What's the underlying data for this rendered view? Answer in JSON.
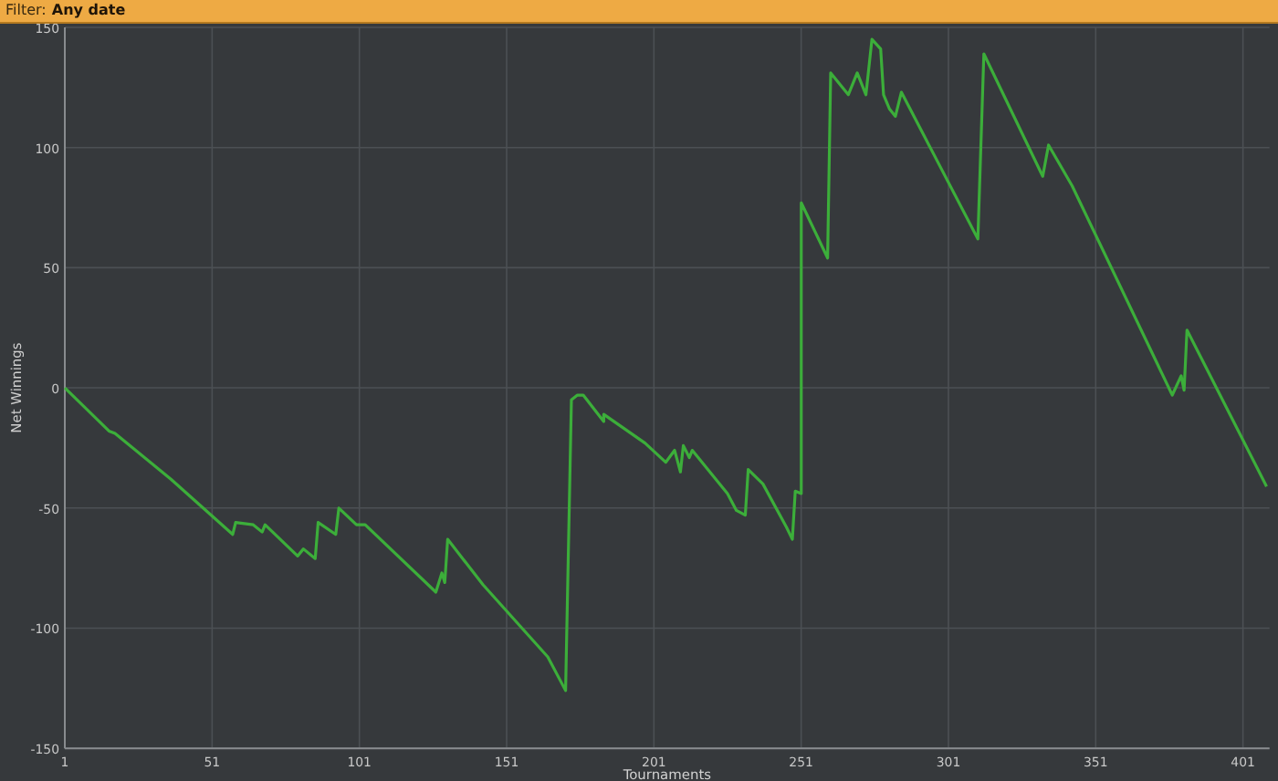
{
  "filter_bar": {
    "label": "Filter:",
    "value": "Any date"
  },
  "chart": {
    "chart_data": {
      "type": "line",
      "xlabel": "Tournaments",
      "ylabel": "Net Winnings",
      "xlim": [
        1,
        410
      ],
      "ylim": [
        -150,
        150
      ],
      "xticks": [
        1,
        51,
        101,
        151,
        201,
        251,
        301,
        351,
        401
      ],
      "yticks": [
        -150,
        -100,
        -50,
        0,
        50,
        100,
        150
      ],
      "x": [
        1,
        16,
        18,
        34,
        37,
        58,
        59,
        65,
        68,
        69,
        80,
        82,
        86,
        87,
        93,
        94,
        100,
        103,
        127,
        129,
        130,
        131,
        143,
        165,
        171,
        173,
        175,
        177,
        184,
        184,
        198,
        205,
        208,
        210,
        211,
        213,
        214,
        226,
        229,
        232,
        233,
        238,
        246,
        248,
        249,
        251,
        251,
        260,
        261,
        267,
        270,
        273,
        275,
        278,
        279,
        281,
        283,
        285,
        311,
        313,
        333,
        335,
        343,
        377,
        380,
        381,
        382,
        409
      ],
      "grid": true,
      "series": [
        {
          "color": "#3cae3a",
          "values": [
            0,
            -18,
            -19,
            -35,
            -38,
            -61,
            -56,
            -57,
            -60,
            -57,
            -70,
            -67,
            -71,
            -56,
            -61,
            -50,
            -57,
            -57,
            -85,
            -77,
            -81,
            -63,
            -82,
            -112,
            -126,
            -5,
            -3,
            -3,
            -14,
            -11,
            -23,
            -31,
            -26,
            -35,
            -24,
            -29,
            -26,
            -44,
            -51,
            -53,
            -34,
            -40,
            -58,
            -63,
            -43,
            -44,
            77,
            54,
            131,
            122,
            131,
            122,
            145,
            141,
            122,
            116,
            113,
            123,
            62,
            139,
            88,
            101,
            84,
            -3,
            5,
            -1,
            24,
            -41
          ]
        }
      ]
    }
  }
}
